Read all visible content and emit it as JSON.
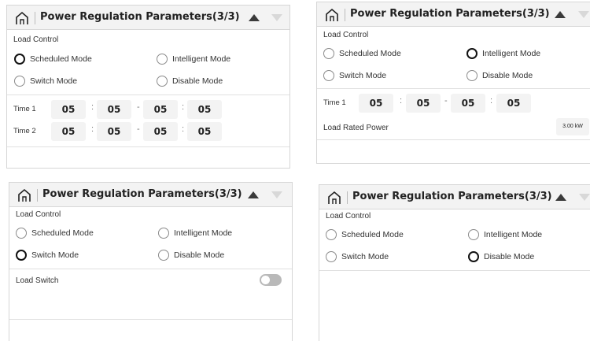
{
  "panels": [
    {
      "title": "Power Regulation Parameters(3/3)",
      "section_label": "Load Control",
      "modes": {
        "scheduled": "Scheduled Mode",
        "intelligent": "Intelligent Mode",
        "switch": "Switch Mode",
        "disable": "Disable Mode"
      },
      "selected_mode": "scheduled",
      "times": [
        {
          "label": "Time 1",
          "start_hour": "05",
          "start_min": "05",
          "end_hour": "05",
          "end_min": "05"
        },
        {
          "label": "Time 2",
          "start_hour": "05",
          "start_min": "05",
          "end_hour": "05",
          "end_min": "05"
        }
      ]
    },
    {
      "title": "Power Regulation Parameters(3/3)",
      "section_label": "Load Control",
      "modes": {
        "scheduled": "Scheduled Mode",
        "intelligent": "Intelligent Mode",
        "switch": "Switch Mode",
        "disable": "Disable Mode"
      },
      "selected_mode": "intelligent",
      "times": [
        {
          "label": "Time 1",
          "start_hour": "05",
          "start_min": "05",
          "end_hour": "05",
          "end_min": "05"
        }
      ],
      "rated_power": {
        "label": "Load Rated Power",
        "value": "3.00 kW"
      }
    },
    {
      "title": "Power Regulation Parameters(3/3)",
      "section_label": "Load Control",
      "modes": {
        "scheduled": "Scheduled Mode",
        "intelligent": "Intelligent Mode",
        "switch": "Switch Mode",
        "disable": "Disable Mode"
      },
      "selected_mode": "switch",
      "load_switch": {
        "label": "Load Switch",
        "on": false
      }
    },
    {
      "title": "Power Regulation Parameters(3/3)",
      "section_label": "Load Control",
      "modes": {
        "scheduled": "Scheduled Mode",
        "intelligent": "Intelligent Mode",
        "switch": "Switch Mode",
        "disable": "Disable Mode"
      },
      "selected_mode": "disable"
    }
  ],
  "icons": {
    "home": "home-icon",
    "up": "arrow-up-icon",
    "down": "arrow-down-icon"
  },
  "colors": {
    "selected_radio": "#111111",
    "unselected_radio": "#8a8a8a",
    "header_bg": "#f3f3f3",
    "arrow_active": "#3a3a3a",
    "arrow_inactive": "#d8d8d8"
  }
}
